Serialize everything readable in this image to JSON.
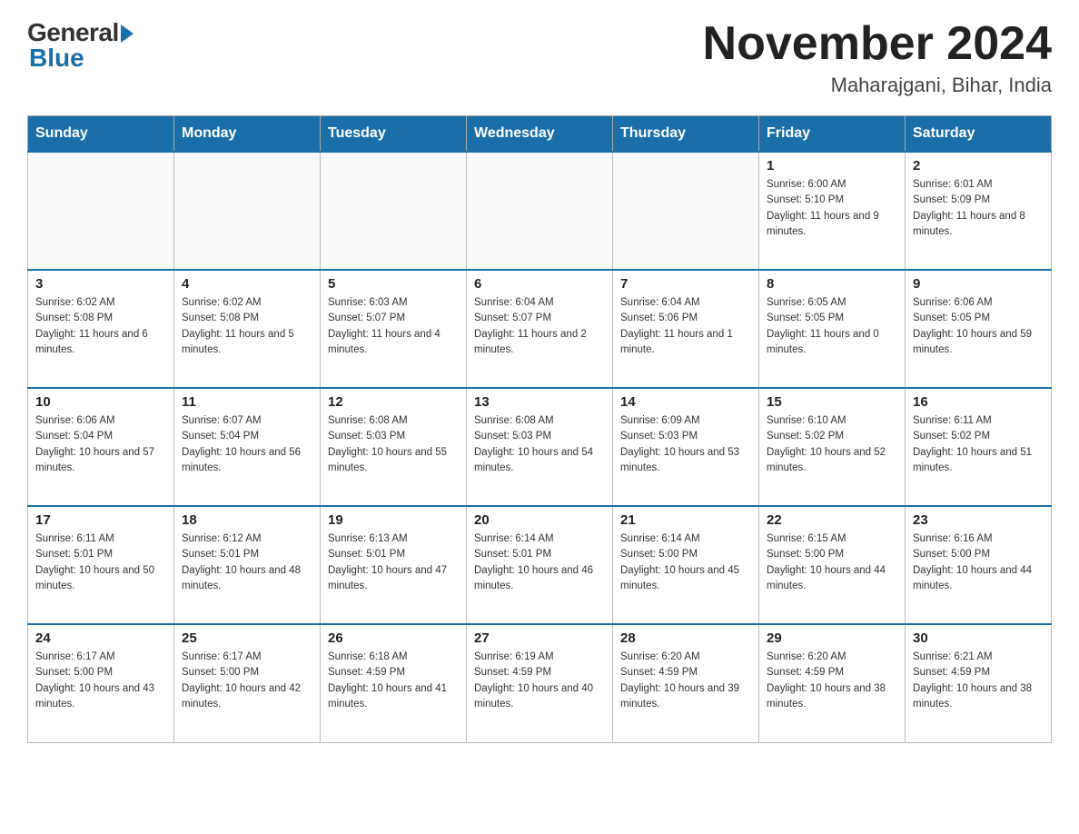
{
  "header": {
    "logo_general": "General",
    "logo_blue": "Blue",
    "month_title": "November 2024",
    "location": "Maharajgani, Bihar, India"
  },
  "days_of_week": [
    "Sunday",
    "Monday",
    "Tuesday",
    "Wednesday",
    "Thursday",
    "Friday",
    "Saturday"
  ],
  "weeks": [
    [
      {
        "num": "",
        "info": ""
      },
      {
        "num": "",
        "info": ""
      },
      {
        "num": "",
        "info": ""
      },
      {
        "num": "",
        "info": ""
      },
      {
        "num": "",
        "info": ""
      },
      {
        "num": "1",
        "info": "Sunrise: 6:00 AM\nSunset: 5:10 PM\nDaylight: 11 hours and 9 minutes."
      },
      {
        "num": "2",
        "info": "Sunrise: 6:01 AM\nSunset: 5:09 PM\nDaylight: 11 hours and 8 minutes."
      }
    ],
    [
      {
        "num": "3",
        "info": "Sunrise: 6:02 AM\nSunset: 5:08 PM\nDaylight: 11 hours and 6 minutes."
      },
      {
        "num": "4",
        "info": "Sunrise: 6:02 AM\nSunset: 5:08 PM\nDaylight: 11 hours and 5 minutes."
      },
      {
        "num": "5",
        "info": "Sunrise: 6:03 AM\nSunset: 5:07 PM\nDaylight: 11 hours and 4 minutes."
      },
      {
        "num": "6",
        "info": "Sunrise: 6:04 AM\nSunset: 5:07 PM\nDaylight: 11 hours and 2 minutes."
      },
      {
        "num": "7",
        "info": "Sunrise: 6:04 AM\nSunset: 5:06 PM\nDaylight: 11 hours and 1 minute."
      },
      {
        "num": "8",
        "info": "Sunrise: 6:05 AM\nSunset: 5:05 PM\nDaylight: 11 hours and 0 minutes."
      },
      {
        "num": "9",
        "info": "Sunrise: 6:06 AM\nSunset: 5:05 PM\nDaylight: 10 hours and 59 minutes."
      }
    ],
    [
      {
        "num": "10",
        "info": "Sunrise: 6:06 AM\nSunset: 5:04 PM\nDaylight: 10 hours and 57 minutes."
      },
      {
        "num": "11",
        "info": "Sunrise: 6:07 AM\nSunset: 5:04 PM\nDaylight: 10 hours and 56 minutes."
      },
      {
        "num": "12",
        "info": "Sunrise: 6:08 AM\nSunset: 5:03 PM\nDaylight: 10 hours and 55 minutes."
      },
      {
        "num": "13",
        "info": "Sunrise: 6:08 AM\nSunset: 5:03 PM\nDaylight: 10 hours and 54 minutes."
      },
      {
        "num": "14",
        "info": "Sunrise: 6:09 AM\nSunset: 5:03 PM\nDaylight: 10 hours and 53 minutes."
      },
      {
        "num": "15",
        "info": "Sunrise: 6:10 AM\nSunset: 5:02 PM\nDaylight: 10 hours and 52 minutes."
      },
      {
        "num": "16",
        "info": "Sunrise: 6:11 AM\nSunset: 5:02 PM\nDaylight: 10 hours and 51 minutes."
      }
    ],
    [
      {
        "num": "17",
        "info": "Sunrise: 6:11 AM\nSunset: 5:01 PM\nDaylight: 10 hours and 50 minutes."
      },
      {
        "num": "18",
        "info": "Sunrise: 6:12 AM\nSunset: 5:01 PM\nDaylight: 10 hours and 48 minutes."
      },
      {
        "num": "19",
        "info": "Sunrise: 6:13 AM\nSunset: 5:01 PM\nDaylight: 10 hours and 47 minutes."
      },
      {
        "num": "20",
        "info": "Sunrise: 6:14 AM\nSunset: 5:01 PM\nDaylight: 10 hours and 46 minutes."
      },
      {
        "num": "21",
        "info": "Sunrise: 6:14 AM\nSunset: 5:00 PM\nDaylight: 10 hours and 45 minutes."
      },
      {
        "num": "22",
        "info": "Sunrise: 6:15 AM\nSunset: 5:00 PM\nDaylight: 10 hours and 44 minutes."
      },
      {
        "num": "23",
        "info": "Sunrise: 6:16 AM\nSunset: 5:00 PM\nDaylight: 10 hours and 44 minutes."
      }
    ],
    [
      {
        "num": "24",
        "info": "Sunrise: 6:17 AM\nSunset: 5:00 PM\nDaylight: 10 hours and 43 minutes."
      },
      {
        "num": "25",
        "info": "Sunrise: 6:17 AM\nSunset: 5:00 PM\nDaylight: 10 hours and 42 minutes."
      },
      {
        "num": "26",
        "info": "Sunrise: 6:18 AM\nSunset: 4:59 PM\nDaylight: 10 hours and 41 minutes."
      },
      {
        "num": "27",
        "info": "Sunrise: 6:19 AM\nSunset: 4:59 PM\nDaylight: 10 hours and 40 minutes."
      },
      {
        "num": "28",
        "info": "Sunrise: 6:20 AM\nSunset: 4:59 PM\nDaylight: 10 hours and 39 minutes."
      },
      {
        "num": "29",
        "info": "Sunrise: 6:20 AM\nSunset: 4:59 PM\nDaylight: 10 hours and 38 minutes."
      },
      {
        "num": "30",
        "info": "Sunrise: 6:21 AM\nSunset: 4:59 PM\nDaylight: 10 hours and 38 minutes."
      }
    ]
  ]
}
